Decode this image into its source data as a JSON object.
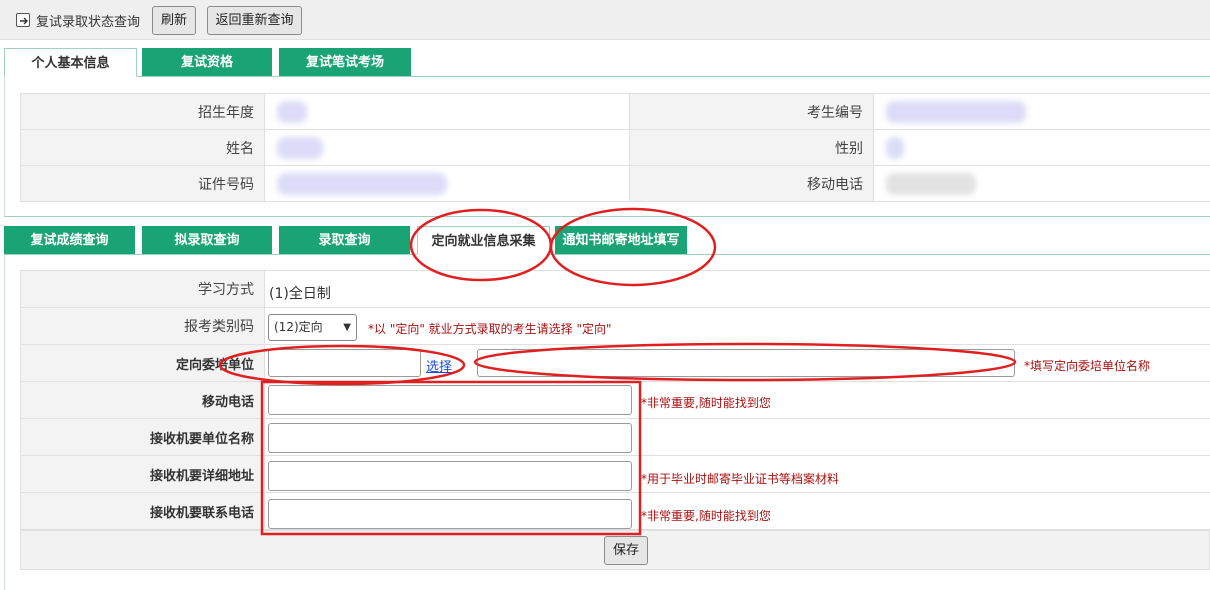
{
  "toolbar": {
    "title": "复试录取状态查询",
    "refresh_label": "刷新",
    "back_label": "返回重新查询"
  },
  "tabs_top": [
    {
      "label": "个人基本信息",
      "active": true
    },
    {
      "label": "复试资格",
      "active": false
    },
    {
      "label": "复试笔试考场",
      "active": false
    }
  ],
  "basic_info": {
    "year_label": "招生年度",
    "exam_no_label": "考生编号",
    "name_label": "姓名",
    "gender_label": "性别",
    "id_label": "证件号码",
    "mobile_label": "移动电话"
  },
  "tabs_mid": [
    {
      "label": "复试成绩查询",
      "active": false
    },
    {
      "label": "拟录取查询",
      "active": false
    },
    {
      "label": "录取查询",
      "active": false
    },
    {
      "label": "定向就业信息采集",
      "active": true
    },
    {
      "label": "通知书邮寄地址填写",
      "active": false
    }
  ],
  "form": {
    "study_mode_label": "学习方式",
    "study_mode_value": "(1)全日制",
    "category_label": "报考类别码",
    "category_value": "(12)定向",
    "category_hint": "*以 \"定向\" 就业方式录取的考生请选择 \"定向\"",
    "unit_label": "定向委培单位",
    "select_link": "选择",
    "unit_hint": "*填写定向委培单位名称",
    "mobile_label": "移动电话",
    "mobile_hint": "*非常重要,随时能找到您",
    "recv_unit_label": "接收机要单位名称",
    "recv_addr_label": "接收机要详细地址",
    "recv_addr_hint": "*用于毕业时邮寄毕业证书等档案材料",
    "recv_phone_label": "接收机要联系电话",
    "recv_phone_hint": "*非常重要,随时能找到您",
    "save_label": "保存"
  },
  "colors": {
    "tab_green": "#1aa374",
    "annotation_red": "#e02020",
    "hint_red": "#a11111"
  }
}
